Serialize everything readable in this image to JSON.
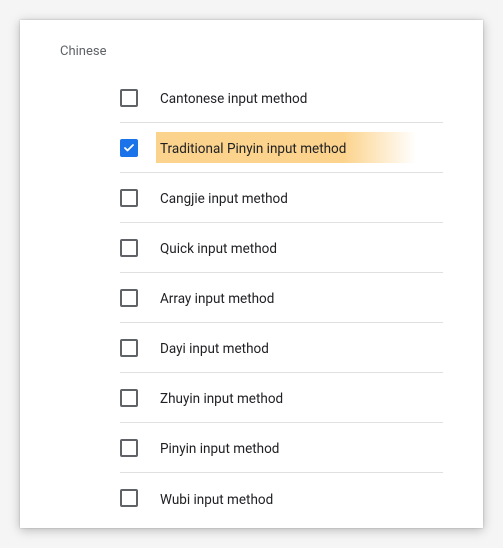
{
  "section_title": "Chinese",
  "items": [
    {
      "label": "Cantonese input method",
      "checked": false,
      "highlighted": false,
      "name": "input-method-cantonese"
    },
    {
      "label": "Traditional Pinyin input method",
      "checked": true,
      "highlighted": true,
      "name": "input-method-traditional-pinyin"
    },
    {
      "label": "Cangjie input method",
      "checked": false,
      "highlighted": false,
      "name": "input-method-cangjie"
    },
    {
      "label": "Quick input method",
      "checked": false,
      "highlighted": false,
      "name": "input-method-quick"
    },
    {
      "label": "Array input method",
      "checked": false,
      "highlighted": false,
      "name": "input-method-array"
    },
    {
      "label": "Dayi input method",
      "checked": false,
      "highlighted": false,
      "name": "input-method-dayi"
    },
    {
      "label": "Zhuyin input method",
      "checked": false,
      "highlighted": false,
      "name": "input-method-zhuyin"
    },
    {
      "label": "Pinyin input method",
      "checked": false,
      "highlighted": false,
      "name": "input-method-pinyin"
    },
    {
      "label": "Wubi input method",
      "checked": false,
      "highlighted": false,
      "name": "input-method-wubi"
    }
  ]
}
